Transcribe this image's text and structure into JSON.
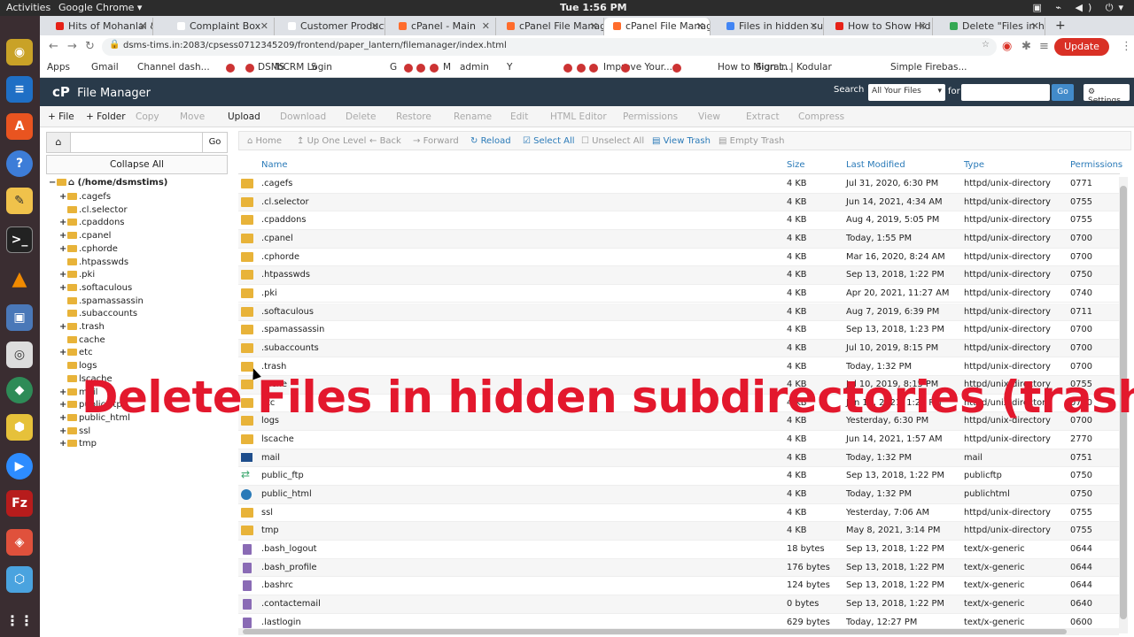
{
  "system_bar": {
    "activities": "Activities",
    "app": "Google Chrome ▾",
    "clock": "Tue  1:56 PM",
    "tray": "▣ ⌁ ◀) ⏻▾"
  },
  "browser": {
    "tabs": [
      {
        "label": "Hits of Mohanlal &",
        "fav_color": "#e62117"
      },
      {
        "label": "Complaint Box",
        "fav_color": "#ffffff"
      },
      {
        "label": "Customer Product",
        "fav_color": "#ffffff"
      },
      {
        "label": "cPanel - Main",
        "fav_color": "#ff6c2c"
      },
      {
        "label": "cPanel File Manag",
        "fav_color": "#ff6c2c"
      },
      {
        "label": "cPanel File Manag",
        "fav_color": "#ff6c2c"
      },
      {
        "label": "Files in hidden sub",
        "fav_color": "#4285f4"
      },
      {
        "label": "How to Show Hid",
        "fav_color": "#e62117"
      },
      {
        "label": "Delete \"Files in hi",
        "fav_color": "#34a853"
      }
    ],
    "new_tab": "+",
    "url": "dsms-tims.in:2083/cpsess0712345209/frontend/paper_lantern/filemanager/index.html",
    "update_label": "Update",
    "bookmarks": [
      "Apps",
      "Gmail",
      "Channel dash...",
      "",
      "",
      "DSMS",
      "lbCRM Login",
      "S",
      "G",
      "",
      "",
      "",
      "M",
      "admin",
      "Y",
      "",
      "",
      "",
      "Improve Your...",
      "",
      "",
      "How to Migrat...",
      "Sign in | Kodular",
      "Simple Firebas..."
    ]
  },
  "filemanager": {
    "title": "File Manager",
    "search_label": "Search",
    "search_scope": "All Your Files",
    "for_label": "for",
    "go_label": "Go",
    "settings_label": "Settings",
    "toolbar": [
      {
        "label": "+ File",
        "enabled": true
      },
      {
        "label": "+ Folder",
        "enabled": true
      },
      {
        "label": "Copy",
        "enabled": false
      },
      {
        "label": "Move",
        "enabled": false
      },
      {
        "label": "Upload",
        "enabled": true
      },
      {
        "label": "Download",
        "enabled": false
      },
      {
        "label": "Delete",
        "enabled": false
      },
      {
        "label": "Restore",
        "enabled": false
      },
      {
        "label": "Rename",
        "enabled": false
      },
      {
        "label": "Edit",
        "enabled": false
      },
      {
        "label": "HTML Editor",
        "enabled": false
      },
      {
        "label": "Permissions",
        "enabled": false
      },
      {
        "label": "View",
        "enabled": false
      },
      {
        "label": "Extract",
        "enabled": false
      },
      {
        "label": "Compress",
        "enabled": false
      }
    ],
    "left": {
      "go_label": "Go",
      "collapse_label": "Collapse All",
      "root": "(/home/dsmstims)",
      "tree": [
        {
          "name": ".cagefs",
          "expandable": true
        },
        {
          "name": ".cl.selector",
          "expandable": false
        },
        {
          "name": ".cpaddons",
          "expandable": true
        },
        {
          "name": ".cpanel",
          "expandable": true
        },
        {
          "name": ".cphorde",
          "expandable": true
        },
        {
          "name": ".htpasswds",
          "expandable": false
        },
        {
          "name": ".pki",
          "expandable": true
        },
        {
          "name": ".softaculous",
          "expandable": true
        },
        {
          "name": ".spamassassin",
          "expandable": false
        },
        {
          "name": ".subaccounts",
          "expandable": false
        },
        {
          "name": ".trash",
          "expandable": true
        },
        {
          "name": "cache",
          "expandable": false
        },
        {
          "name": "etc",
          "expandable": true
        },
        {
          "name": "logs",
          "expandable": false
        },
        {
          "name": "lscache",
          "expandable": false
        },
        {
          "name": "mail",
          "expandable": true
        },
        {
          "name": "public_ftp",
          "expandable": true
        },
        {
          "name": "public_html",
          "expandable": true
        },
        {
          "name": "ssl",
          "expandable": true
        },
        {
          "name": "tmp",
          "expandable": true
        }
      ]
    },
    "subbar": [
      {
        "label": "Home",
        "enabled": false
      },
      {
        "label": "Up One Level",
        "enabled": false
      },
      {
        "label": "Back",
        "enabled": false
      },
      {
        "label": "Forward",
        "enabled": false
      },
      {
        "label": "Reload",
        "enabled": true
      },
      {
        "label": "Select All",
        "enabled": true
      },
      {
        "label": "Unselect All",
        "enabled": false
      },
      {
        "label": "View Trash",
        "enabled": true
      },
      {
        "label": "Empty Trash",
        "enabled": false
      }
    ],
    "columns": [
      "Name",
      "Size",
      "Last Modified",
      "Type",
      "Permissions"
    ],
    "files": [
      {
        "icon": "folder",
        "name": ".cagefs",
        "size": "4 KB",
        "modified": "Jul 31, 2020, 6:30 PM",
        "type": "httpd/unix-directory",
        "perm": "0771"
      },
      {
        "icon": "folder",
        "name": ".cl.selector",
        "size": "4 KB",
        "modified": "Jun 14, 2021, 4:34 AM",
        "type": "httpd/unix-directory",
        "perm": "0755"
      },
      {
        "icon": "folder",
        "name": ".cpaddons",
        "size": "4 KB",
        "modified": "Aug 4, 2019, 5:05 PM",
        "type": "httpd/unix-directory",
        "perm": "0755"
      },
      {
        "icon": "folder",
        "name": ".cpanel",
        "size": "4 KB",
        "modified": "Today, 1:55 PM",
        "type": "httpd/unix-directory",
        "perm": "0700"
      },
      {
        "icon": "folder",
        "name": ".cphorde",
        "size": "4 KB",
        "modified": "Mar 16, 2020, 8:24 AM",
        "type": "httpd/unix-directory",
        "perm": "0700"
      },
      {
        "icon": "folder",
        "name": ".htpasswds",
        "size": "4 KB",
        "modified": "Sep 13, 2018, 1:22 PM",
        "type": "httpd/unix-directory",
        "perm": "0750"
      },
      {
        "icon": "folder",
        "name": ".pki",
        "size": "4 KB",
        "modified": "Apr 20, 2021, 11:27 AM",
        "type": "httpd/unix-directory",
        "perm": "0740"
      },
      {
        "icon": "folder",
        "name": ".softaculous",
        "size": "4 KB",
        "modified": "Aug 7, 2019, 6:39 PM",
        "type": "httpd/unix-directory",
        "perm": "0711"
      },
      {
        "icon": "folder",
        "name": ".spamassassin",
        "size": "4 KB",
        "modified": "Sep 13, 2018, 1:23 PM",
        "type": "httpd/unix-directory",
        "perm": "0700"
      },
      {
        "icon": "folder",
        "name": ".subaccounts",
        "size": "4 KB",
        "modified": "Jul 10, 2019, 8:15 PM",
        "type": "httpd/unix-directory",
        "perm": "0700"
      },
      {
        "icon": "folder",
        "name": ".trash",
        "size": "4 KB",
        "modified": "Today, 1:32 PM",
        "type": "httpd/unix-directory",
        "perm": "0700"
      },
      {
        "icon": "folder",
        "name": "cache",
        "size": "4 KB",
        "modified": "Jul 10, 2019, 8:15 PM",
        "type": "httpd/unix-directory",
        "perm": "0755"
      },
      {
        "icon": "folder",
        "name": "etc",
        "size": "4 KB",
        "modified": "Jun 10, 2021, 1:20 PM",
        "type": "httpd/unix-directory",
        "perm": "0750"
      },
      {
        "icon": "folder",
        "name": "logs",
        "size": "4 KB",
        "modified": "Yesterday, 6:30 PM",
        "type": "httpd/unix-directory",
        "perm": "0700"
      },
      {
        "icon": "folder",
        "name": "lscache",
        "size": "4 KB",
        "modified": "Jun 14, 2021, 1:57 AM",
        "type": "httpd/unix-directory",
        "perm": "2770"
      },
      {
        "icon": "mail",
        "name": "mail",
        "size": "4 KB",
        "modified": "Today, 1:32 PM",
        "type": "mail",
        "perm": "0751"
      },
      {
        "icon": "ftp",
        "name": "public_ftp",
        "size": "4 KB",
        "modified": "Sep 13, 2018, 1:22 PM",
        "type": "publicftp",
        "perm": "0750"
      },
      {
        "icon": "www",
        "name": "public_html",
        "size": "4 KB",
        "modified": "Today, 1:32 PM",
        "type": "publichtml",
        "perm": "0750"
      },
      {
        "icon": "folder",
        "name": "ssl",
        "size": "4 KB",
        "modified": "Yesterday, 7:06 AM",
        "type": "httpd/unix-directory",
        "perm": "0755"
      },
      {
        "icon": "folder",
        "name": "tmp",
        "size": "4 KB",
        "modified": "May 8, 2021, 3:14 PM",
        "type": "httpd/unix-directory",
        "perm": "0755"
      },
      {
        "icon": "file",
        "name": ".bash_logout",
        "size": "18 bytes",
        "modified": "Sep 13, 2018, 1:22 PM",
        "type": "text/x-generic",
        "perm": "0644"
      },
      {
        "icon": "file",
        "name": ".bash_profile",
        "size": "176 bytes",
        "modified": "Sep 13, 2018, 1:22 PM",
        "type": "text/x-generic",
        "perm": "0644"
      },
      {
        "icon": "file",
        "name": ".bashrc",
        "size": "124 bytes",
        "modified": "Sep 13, 2018, 1:22 PM",
        "type": "text/x-generic",
        "perm": "0644"
      },
      {
        "icon": "file",
        "name": ".contactemail",
        "size": "0 bytes",
        "modified": "Sep 13, 2018, 1:22 PM",
        "type": "text/x-generic",
        "perm": "0640"
      },
      {
        "icon": "file",
        "name": ".lastlogin",
        "size": "629 bytes",
        "modified": "Today, 12:27 PM",
        "type": "text/x-generic",
        "perm": "0600"
      }
    ]
  },
  "overlay_text": "Delete Files in hidden subdirectories (trash)"
}
